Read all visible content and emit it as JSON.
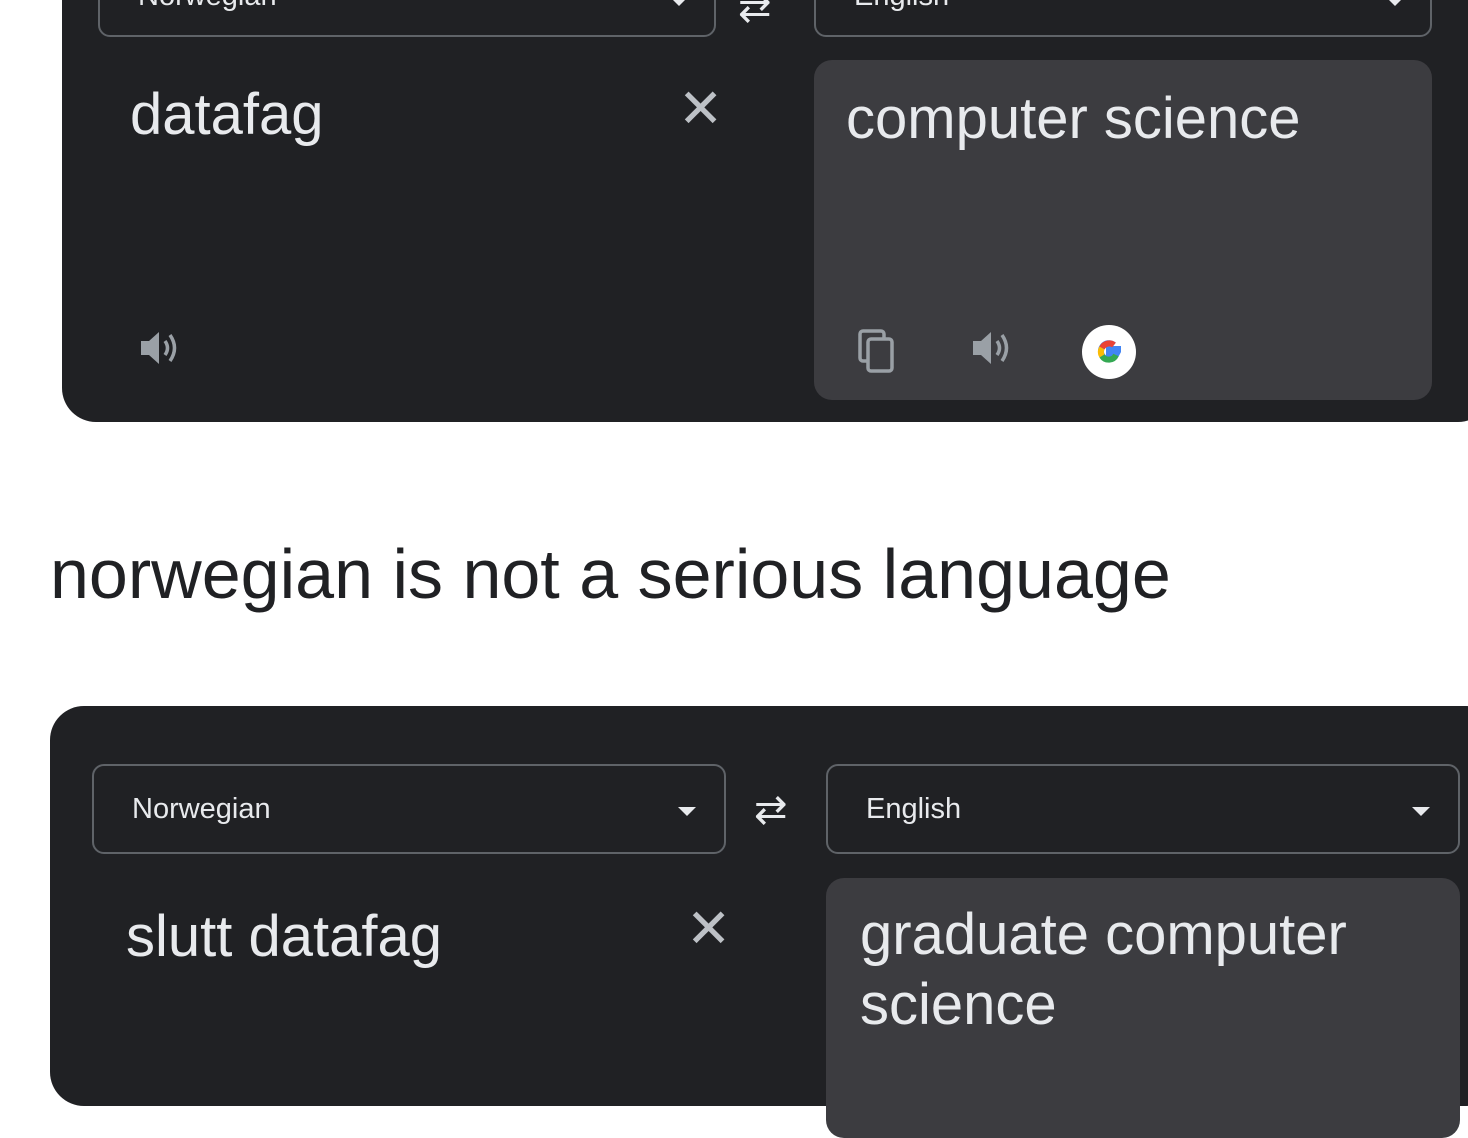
{
  "top_panel": {
    "source_language": "Norwegian",
    "target_language": "English",
    "source_text": "datafag",
    "translated_text": "computer science",
    "icons": [
      "swap-icon",
      "clear-icon",
      "speaker-icon",
      "copy-icon",
      "speaker-icon",
      "google-icon"
    ]
  },
  "caption": "norwegian is not a serious language",
  "bottom_panel": {
    "source_language": "Norwegian",
    "target_language": "English",
    "source_text": "slutt datafag",
    "translated_text": "graduate computer science",
    "icons": [
      "swap-icon",
      "clear-icon"
    ]
  },
  "colors": {
    "panel_bg": "#202124",
    "output_bg": "#3c3c40",
    "text": "#e8eaed",
    "border": "#5f6368",
    "page_bg": "#ffffff",
    "caption": "#202124"
  }
}
